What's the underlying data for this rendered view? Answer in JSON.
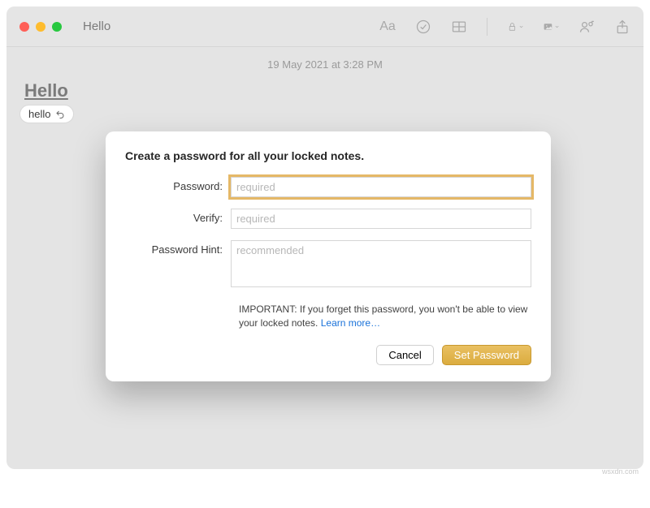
{
  "window": {
    "title": "Hello"
  },
  "toolbar": {
    "format_icon": "Aa",
    "checklist_icon": "checklist",
    "table_icon": "table",
    "lock_icon": "lock",
    "media_icon": "media",
    "collab_icon": "collaborate",
    "share_icon": "share"
  },
  "note": {
    "datetime": "19 May 2021 at 3:28 PM",
    "title": "Hello",
    "suggestion": "hello"
  },
  "dialog": {
    "title": "Create a password for all your locked notes.",
    "password_label": "Password:",
    "password_placeholder": "required",
    "verify_label": "Verify:",
    "verify_placeholder": "required",
    "hint_label": "Password Hint:",
    "hint_placeholder": "recommended",
    "important_prefix": "IMPORTANT: If you forget this password, you won't be able to view your locked notes. ",
    "learn_more": "Learn more…",
    "cancel": "Cancel",
    "set_password": "Set Password"
  },
  "watermark": "wsxdn.com"
}
